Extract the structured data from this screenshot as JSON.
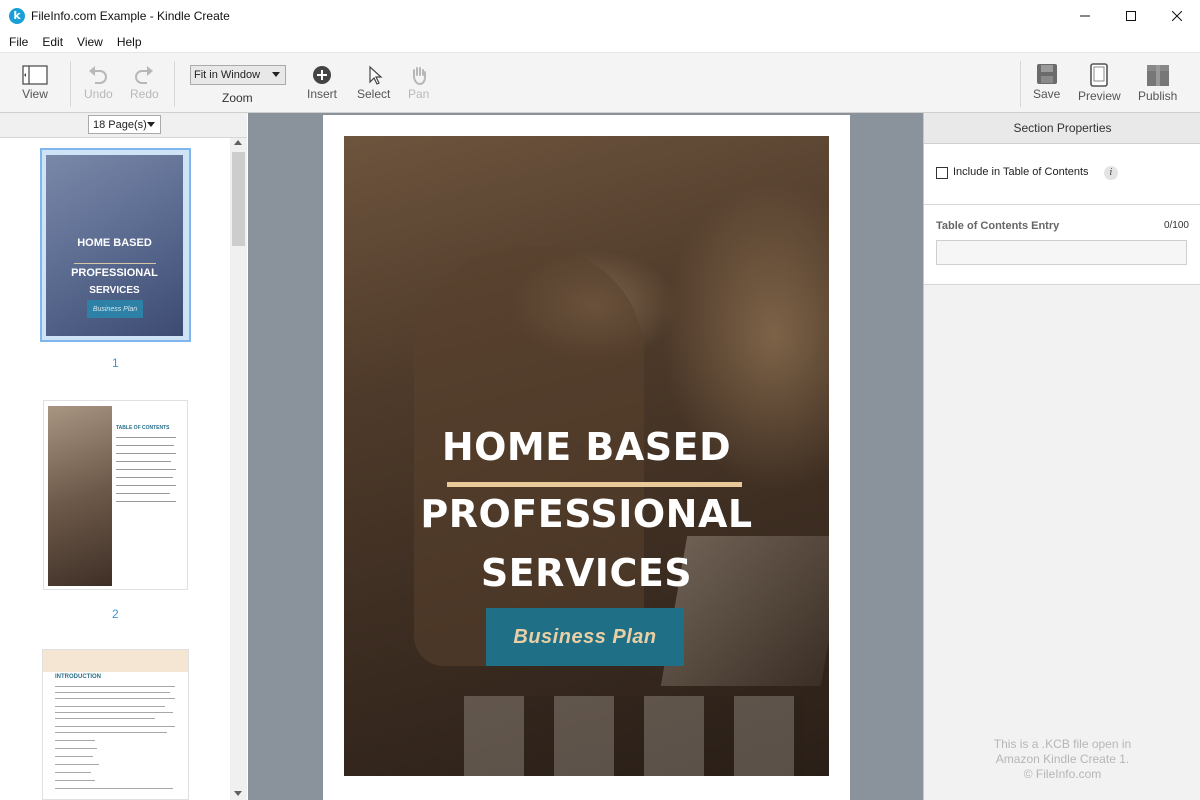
{
  "window": {
    "title": "FileInfo.com Example - Kindle Create",
    "app_icon_letter": "k"
  },
  "menu": [
    "File",
    "Edit",
    "View",
    "Help"
  ],
  "toolbar": {
    "view_label": "View",
    "undo_label": "Undo",
    "redo_label": "Redo",
    "zoom_value": "Fit in Window",
    "zoom_label": "Zoom",
    "insert_label": "Insert",
    "select_label": "Select",
    "pan_label": "Pan",
    "save_label": "Save",
    "preview_label": "Preview",
    "publish_label": "Publish"
  },
  "pages_panel": {
    "page_count": "18 Page(s)",
    "thumbnails": [
      {
        "number": "1",
        "title_lines": [
          "HOME BASED",
          "PROFESSIONAL",
          "SERVICES"
        ],
        "subtitle": "Business Plan"
      },
      {
        "number": "2",
        "heading": "TABLE OF CONTENTS"
      },
      {
        "heading": "INTRODUCTION"
      }
    ]
  },
  "cover": {
    "line1": "HOME BASED",
    "line2": "PROFESSIONAL",
    "line3": "SERVICES",
    "button": "Business Plan"
  },
  "section_properties": {
    "header": "Section Properties",
    "include_toc_label": "Include in Table of Contents",
    "include_toc_checked": false,
    "info_icon": "i",
    "toc_entry_label": "Table of Contents Entry",
    "toc_counter": "0/100",
    "toc_entry_value": ""
  },
  "watermark": {
    "line1": "This is a .KCB file open in",
    "line2": "Amazon Kindle Create 1.",
    "line3": "© FileInfo.com"
  },
  "colors": {
    "accent_blue": "#3e96d6",
    "cover_button": "#1f6f86",
    "cover_rule": "#e9c99a",
    "canvas_bg": "#8a939c"
  }
}
